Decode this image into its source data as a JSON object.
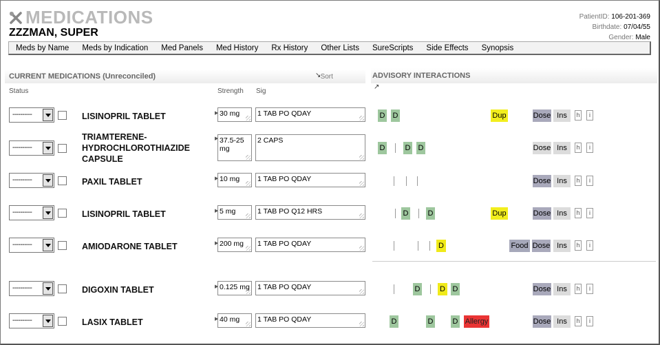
{
  "app": {
    "title": "MEDICATIONS",
    "icon": "tools-icon"
  },
  "patient": {
    "name": "ZZZMAN, SUPER",
    "id_label": "PatientID:",
    "id": "106-201-369",
    "birth_label": "Birthdate:",
    "birthdate": "07/04/55",
    "gender_label": "Gender:",
    "gender": "Male"
  },
  "nav": [
    "Meds by Name",
    "Meds by Indication",
    "Med Panels",
    "Med History",
    "Rx History",
    "Other Lists",
    "SureScripts",
    "Side Effects",
    "Synopsis"
  ],
  "current_header": "CURRENT MEDICATIONS (Unreconciled)",
  "sort_label": "Sort",
  "advisory_header": "ADVISORY INTERACTIONS",
  "columns": {
    "status": "Status",
    "strength": "Strength",
    "sig": "Sig"
  },
  "status_default": "----------",
  "meds": [
    {
      "name": "LISINOPRIL TABLET",
      "strength": "30 mg",
      "sig": "1 TAB PO QDAY",
      "interactions": [
        "D",
        "D"
      ],
      "dup": "Dup",
      "food": "",
      "allergy": ""
    },
    {
      "name": "TRIAMTERENE-HYDROCHLOROTHIAZIDE CAPSULE",
      "strength": "37.5-25 mg",
      "sig": "2 CAPS",
      "interactions": [
        "D",
        "D",
        "D"
      ],
      "dup": "",
      "food": "",
      "allergy": ""
    },
    {
      "name": "PAXIL TABLET",
      "strength": "10 mg",
      "sig": "1 TAB PO QDAY",
      "interactions": [],
      "dup": "",
      "food": "",
      "allergy": ""
    },
    {
      "name": "LISINOPRIL TABLET",
      "strength": "5 mg",
      "sig": "1 TAB PO Q12 HRS",
      "interactions": [
        "D",
        "D"
      ],
      "dup": "Dup",
      "food": "",
      "allergy": ""
    },
    {
      "name": "AMIODARONE TABLET",
      "strength": "200 mg",
      "sig": "1 TAB PO QDAY",
      "interactions": [
        "D"
      ],
      "dup": "",
      "food": "Food",
      "allergy": ""
    },
    {
      "name": "DIGOXIN TABLET",
      "strength": "0.125 mg",
      "sig": "1 TAB PO QDAY",
      "interactions": [
        "D",
        "D",
        "D"
      ],
      "dup": "",
      "food": "",
      "allergy": ""
    },
    {
      "name": "LASIX TABLET",
      "strength": "40 mg",
      "sig": "1 TAB PO QDAY",
      "interactions": [
        "D",
        "D",
        "D"
      ],
      "dup": "",
      "food": "",
      "allergy": "Allergy"
    }
  ],
  "action_labels": {
    "dose": "Dose",
    "ins": "Ins",
    "h": "h",
    "i": "i"
  },
  "colors": {
    "drug_interaction": "#9ec79e",
    "major_interaction": "#f0ea1a",
    "duplicate": "#f2ee1e",
    "allergy": "#ea3434",
    "dose": "#a9a9bb",
    "food": "#a6a8ba"
  }
}
